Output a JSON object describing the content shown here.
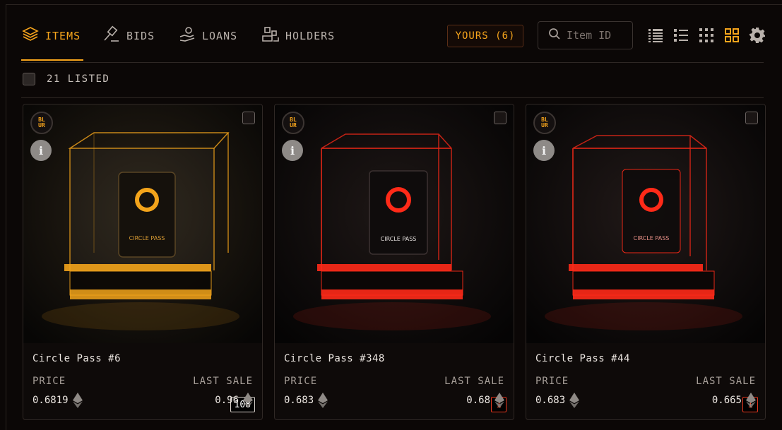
{
  "tabs": [
    {
      "label": "ITEMS",
      "icon": "stack-icon",
      "active": true
    },
    {
      "label": "BIDS",
      "icon": "gavel-icon",
      "active": false
    },
    {
      "label": "LOANS",
      "icon": "hand-coins-icon",
      "active": false
    },
    {
      "label": "HOLDERS",
      "icon": "users-icon",
      "active": false
    }
  ],
  "yours_label": "YOURS (6)",
  "search": {
    "placeholder": "Item ID"
  },
  "view_icons": [
    "list-detailed-icon",
    "list-checklist-icon",
    "grid-small-icon",
    "grid-large-icon",
    "gear-icon"
  ],
  "listed_label": "21 LISTED",
  "price_label": "PRICE",
  "last_sale_label": "LAST SALE",
  "badge": {
    "text": "BLUR"
  },
  "info_glyph": "i",
  "cards": [
    {
      "name": "Circle Pass #6",
      "price": "0.6819",
      "last_sale": "0.96",
      "rank": "108",
      "accent": "#f3a41b",
      "print": "CIRCLE PASS"
    },
    {
      "name": "Circle Pass #348",
      "price": "0.683",
      "last_sale": "0.68",
      "rank": "1",
      "accent": "#ff2a18",
      "print": "CIRCLE PASS"
    },
    {
      "name": "Circle Pass #44",
      "price": "0.683",
      "last_sale": "0.665",
      "rank": "1",
      "accent": "#ff2a18",
      "print": "CIRCLE PASS"
    }
  ],
  "colors": {
    "accent": "#f7a51c",
    "background": "#0b0706",
    "rank_red": "#ff4b2b"
  }
}
